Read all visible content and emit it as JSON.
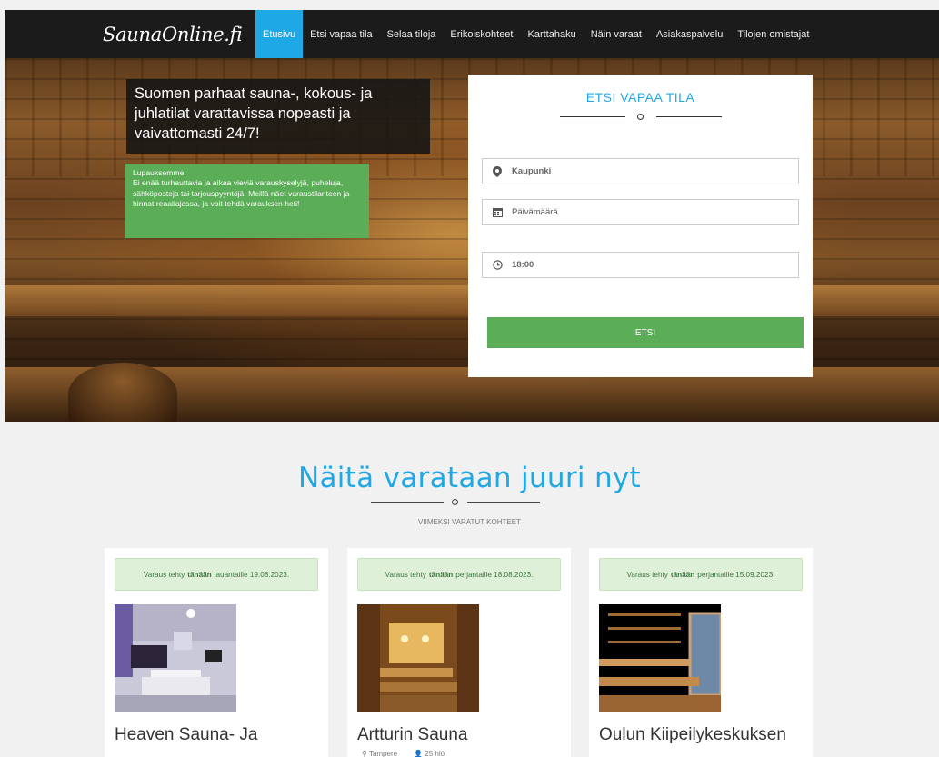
{
  "brand": {
    "logo": "SaunaOnline.fi"
  },
  "nav": {
    "items": [
      {
        "label": "Etusivu",
        "active": true
      },
      {
        "label": "Etsi vapaa tila"
      },
      {
        "label": "Selaa tiloja"
      },
      {
        "label": "Erikoiskohteet"
      },
      {
        "label": "Karttahaku"
      },
      {
        "label": "Näin varaat"
      },
      {
        "label": "Asiakaspalvelu"
      },
      {
        "label": "Tilojen omistajat"
      }
    ]
  },
  "hero": {
    "tagline": "Suomen parhaat sauna-, kokous- ja juhlatilat varattavissa nopeasti ja vaivattomasti 24/7!",
    "promise_title": "Lupauksemme:",
    "promise_text": "Ei enää turhauttavia ja aikaa vieviä varauskyselyjä, puheluja, sähköposteja tai tarjouspyyntöjä. Meillä näet varaustilanteen ja hinnat reaaliajassa, ja voit tehdä varauksen heti!"
  },
  "search": {
    "title": "ETSI VAPAA TILA",
    "city_placeholder": "Kaupunki",
    "date_placeholder": "Päivämäärä",
    "time_value": "18:00",
    "button": "ETSI"
  },
  "section": {
    "title": "Näitä varataan juuri nyt",
    "subtitle": "VIIMEKSI VARATUT KOHTEET"
  },
  "listings": [
    {
      "pre": "Varaus tehty",
      "bold": "tänään",
      "post": "lauantaille 19.08.2023.",
      "name": "Heaven Sauna- Ja",
      "city": "",
      "people": ""
    },
    {
      "pre": "Varaus tehty",
      "bold": "tänään",
      "post": "perjantaille 18.08.2023.",
      "name": "Artturin Sauna",
      "city": "Tampere",
      "people": "25 hlö"
    },
    {
      "pre": "Varaus tehty",
      "bold": "tänään",
      "post": "perjantaille 15.09.2023.",
      "name": "Oulun Kiipeilykeskuksen",
      "city": "",
      "people": ""
    }
  ],
  "colors": {
    "accent": "#1fa8e6",
    "green": "#5cad57",
    "nav_bg": "#1b1b1b"
  }
}
